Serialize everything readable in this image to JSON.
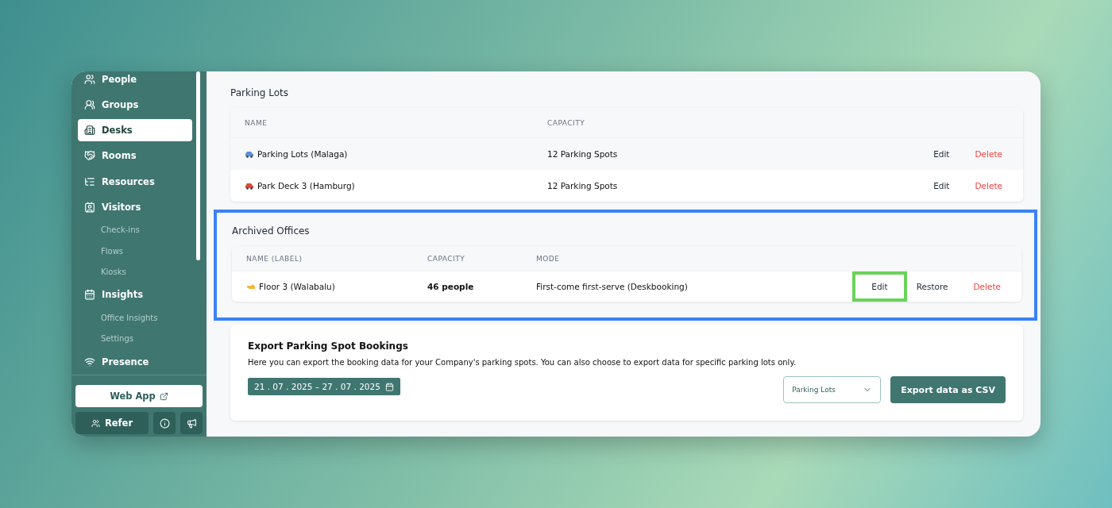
{
  "sidebar": {
    "items": [
      {
        "label": "People",
        "selected": false
      },
      {
        "label": "Groups",
        "selected": false
      },
      {
        "label": "Desks",
        "selected": true
      },
      {
        "label": "Rooms",
        "selected": false
      },
      {
        "label": "Resources",
        "selected": false
      },
      {
        "label": "Visitors",
        "selected": false,
        "children": [
          {
            "label": "Check-ins",
            "selected": false
          },
          {
            "label": "Flows",
            "selected": false
          },
          {
            "label": "Kiosks",
            "selected": false
          }
        ]
      },
      {
        "label": "Insights",
        "selected": false,
        "children": [
          {
            "label": "Office Insights",
            "selected": false
          },
          {
            "label": "Settings",
            "selected": false
          }
        ]
      },
      {
        "label": "Presence",
        "selected": false
      }
    ],
    "web_app_button": "Web App",
    "refer_button": "Refer"
  },
  "parking_lots": {
    "title": "Parking Lots",
    "columns": [
      "NAME",
      "CAPACITY"
    ],
    "rows": [
      {
        "name": "Parking Lots (Malaga)",
        "capacity": "12 Parking Spots",
        "actions": [
          {
            "label": "Edit",
            "kind": "edit",
            "highlighted": false
          },
          {
            "label": "Delete",
            "kind": "delete",
            "highlighted": false
          }
        ]
      },
      {
        "name": "Park Deck 3 (Hamburg)",
        "capacity": "12 Parking Spots",
        "actions": [
          {
            "label": "Edit",
            "kind": "edit",
            "highlighted": false
          },
          {
            "label": "Delete",
            "kind": "delete",
            "highlighted": false
          }
        ]
      }
    ]
  },
  "archived_offices": {
    "title": "Archived Offices",
    "highlighted": true,
    "columns": [
      "NAME (LABEL)",
      "CAPACITY",
      "MODE"
    ],
    "rows": [
      {
        "name": "Floor 3 (Walabalu)",
        "capacity": "46 people",
        "mode": "First-come first-serve (Deskbooking)",
        "actions": [
          {
            "label": "Edit",
            "kind": "edit",
            "highlighted": true
          },
          {
            "label": "Restore",
            "kind": "restore",
            "highlighted": false
          },
          {
            "label": "Delete",
            "kind": "delete",
            "highlighted": false
          }
        ]
      }
    ]
  },
  "export": {
    "title": "Export Parking Spot Bookings",
    "description": "Here you can export the booking data for your Company's parking spots. You can also choose to export data for specific parking lots only.",
    "date_range": "21 . 07 . 2025 – 27 . 07 . 2025",
    "select": {
      "value": "Parking Lots"
    },
    "button": "Export data as CSV"
  }
}
